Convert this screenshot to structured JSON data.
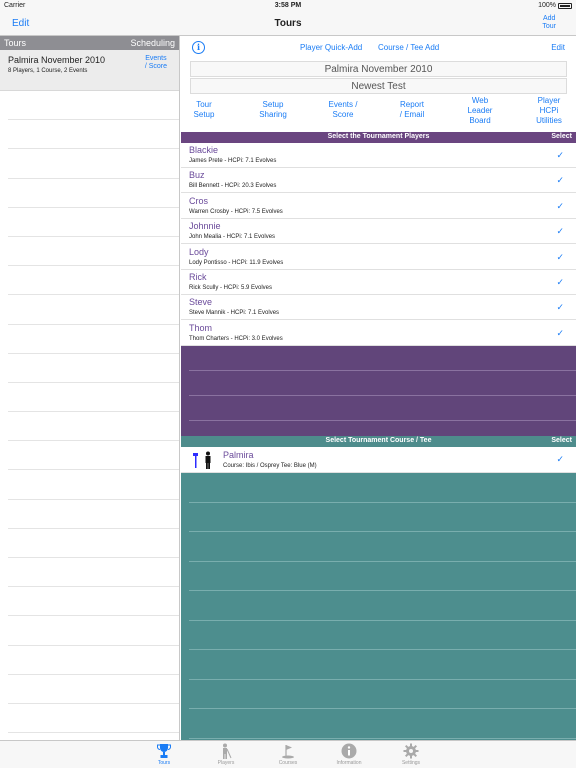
{
  "status_bar": {
    "carrier": "Carrier",
    "time": "3:58 PM",
    "battery": "100%"
  },
  "nav": {
    "edit": "Edit",
    "title": "Tours",
    "add_line1": "Add",
    "add_line2": "Tour"
  },
  "left": {
    "header_left": "Tours",
    "header_right": "Scheduling",
    "tour": {
      "name": "Palmira November 2010",
      "sub": "8 Players, 1 Course, 2 Events",
      "events_line1": "Events",
      "events_line2": "/ Score"
    }
  },
  "right": {
    "info_icon": "info-icon",
    "player_quick_add": "Player Quick-Add",
    "course_tee_add": "Course / Tee Add",
    "edit": "Edit",
    "tour_title": "Palmira November 2010",
    "tour_subtitle": "Newest Test",
    "menu": [
      {
        "l1": "Tour",
        "l2": "Setup",
        "l3": ""
      },
      {
        "l1": "Setup",
        "l2": "Sharing",
        "l3": ""
      },
      {
        "l1": "Events /",
        "l2": "Score",
        "l3": ""
      },
      {
        "l1": "Report",
        "l2": "/ Email",
        "l3": ""
      },
      {
        "l1": "Web",
        "l2": "Leader",
        "l3": "Board"
      },
      {
        "l1": "Player",
        "l2": "HCPi",
        "l3": "Utilities"
      }
    ],
    "players_header": "Select the Tournament Players",
    "players_select": "Select",
    "players": [
      {
        "name": "Blackie",
        "detail": "James Prete - HCPi: 7.1 Evolves"
      },
      {
        "name": "Buz",
        "detail": "Bill Bennett - HCPi: 20.3 Evolves"
      },
      {
        "name": "Cros",
        "detail": "Warren Crosby - HCPi: 7.5 Evolves"
      },
      {
        "name": "Johnnie",
        "detail": "John Mealia - HCPi: 7.1 Evolves"
      },
      {
        "name": "Lody",
        "detail": "Lody Pontisso - HCPi: 11.9 Evolves"
      },
      {
        "name": "Rick",
        "detail": "Rick Scully - HCPi: 5.9 Evolves"
      },
      {
        "name": "Steve",
        "detail": "Steve Mannik - HCPi: 7.1 Evolves"
      },
      {
        "name": "Thom",
        "detail": "Thom Charters - HCPi: 3.0 Evolves"
      }
    ],
    "check_mark": "✓",
    "course_header": "Select Tournament Course / Tee",
    "course_select": "Select",
    "course": {
      "name": "Palmira",
      "detail": "Course: Ibis / Osprey Tee: Blue (M)"
    }
  },
  "tabs": [
    {
      "label": "Tours",
      "icon": "trophy-icon",
      "active": true
    },
    {
      "label": "Players",
      "icon": "golfer-icon",
      "active": false
    },
    {
      "label": "Courses",
      "icon": "flag-icon",
      "active": false
    },
    {
      "label": "Information",
      "icon": "info-icon",
      "active": false
    },
    {
      "label": "Settings",
      "icon": "gear-icon",
      "active": false
    }
  ],
  "colors": {
    "accent": "#1a7cf5",
    "players_purple": "#61457a",
    "course_teal": "#4d8e8e"
  }
}
